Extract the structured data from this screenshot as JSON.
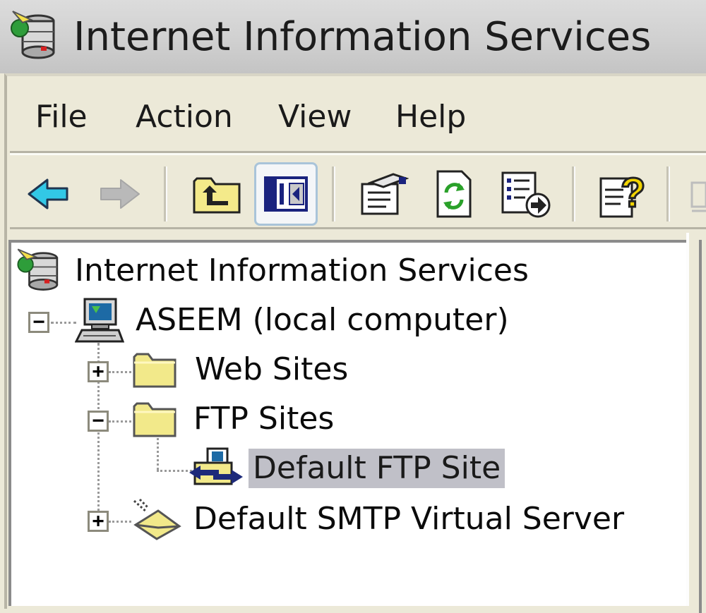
{
  "window": {
    "title": "Internet Information Services",
    "title_icon": "iis-server-icon"
  },
  "menu": {
    "items": [
      "File",
      "Action",
      "View",
      "Help"
    ]
  },
  "toolbar": {
    "buttons": [
      {
        "icon": "back-arrow-icon",
        "enabled": true
      },
      {
        "icon": "forward-arrow-icon",
        "enabled": false
      },
      {
        "icon": "up-folder-icon",
        "enabled": true
      },
      {
        "icon": "show-hide-console-tree-icon",
        "enabled": true,
        "pressed": true
      },
      {
        "icon": "properties-icon",
        "enabled": true
      },
      {
        "icon": "refresh-icon",
        "enabled": true
      },
      {
        "icon": "export-list-icon",
        "enabled": true
      },
      {
        "icon": "help-icon",
        "enabled": true
      }
    ]
  },
  "tree": {
    "root": {
      "label": "Internet Information Services",
      "icon": "iis-server-icon"
    },
    "computer": {
      "label": "ASEEM (local computer)",
      "icon": "computer-icon",
      "expanded": true
    },
    "web_sites": {
      "label": "Web Sites",
      "icon": "folder-icon",
      "expanded": false
    },
    "ftp_sites": {
      "label": "FTP Sites",
      "icon": "folder-icon",
      "expanded": true
    },
    "default_ftp": {
      "label": "Default FTP Site",
      "icon": "ftp-site-icon",
      "selected": true
    },
    "smtp": {
      "label": "Default SMTP Virtual Server",
      "icon": "smtp-server-icon",
      "expanded": false
    }
  },
  "colors": {
    "selection": "#c0c0c8",
    "folder": "#f2e98a",
    "back_arrow": "#32c8e6"
  }
}
